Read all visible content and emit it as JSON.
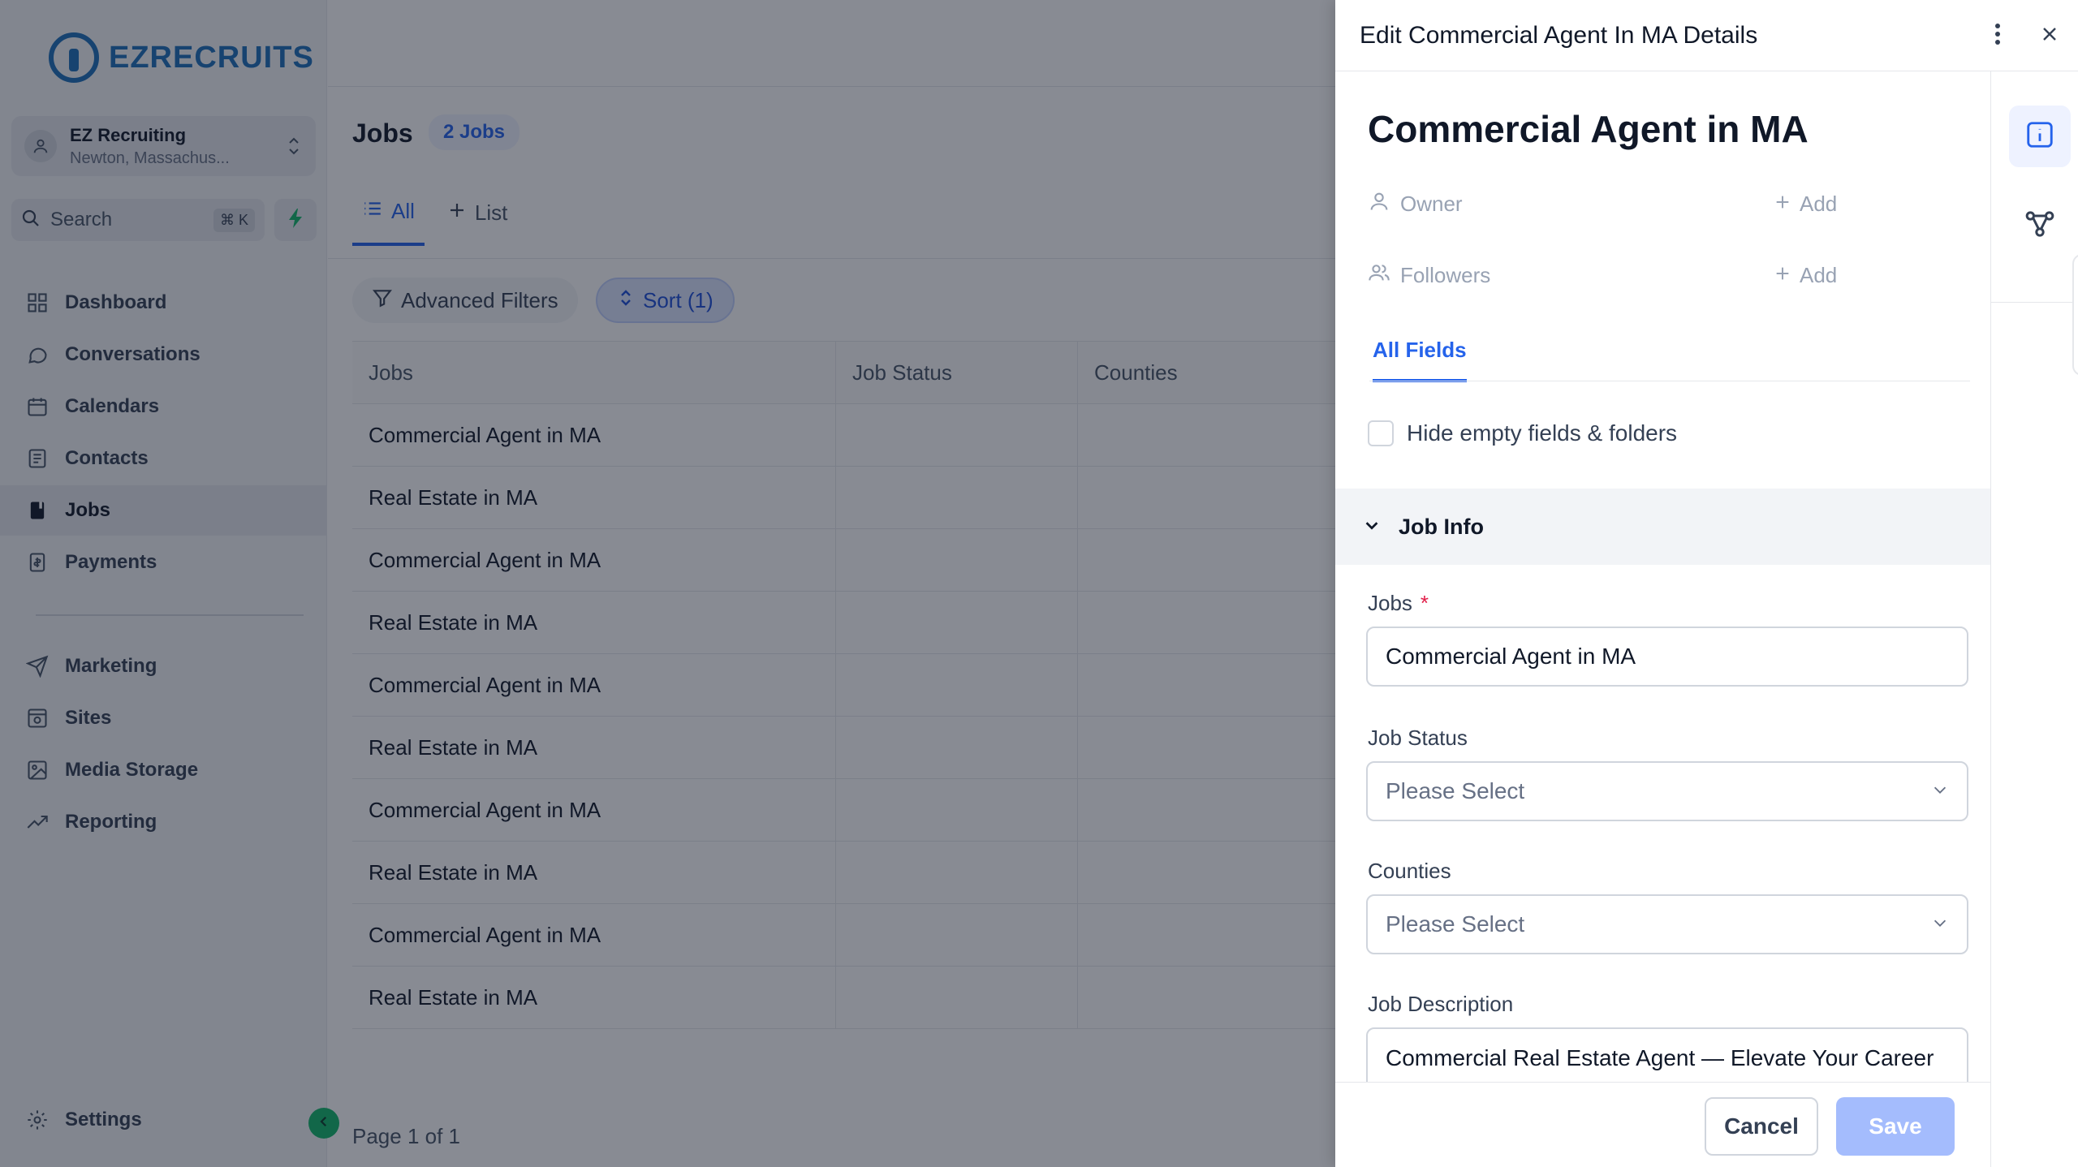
{
  "brand": {
    "name": "EZRECRUITS"
  },
  "account": {
    "name": "EZ Recruiting",
    "location": "Newton, Massachus..."
  },
  "search": {
    "label": "Search",
    "shortcut": "⌘ K"
  },
  "nav": {
    "dashboard": "Dashboard",
    "conversations": "Conversations",
    "calendars": "Calendars",
    "contacts": "Contacts",
    "jobs": "Jobs",
    "payments": "Payments",
    "marketing": "Marketing",
    "sites": "Sites",
    "media_storage": "Media Storage",
    "reporting": "Reporting",
    "settings": "Settings"
  },
  "main": {
    "title": "Jobs",
    "count_badge": "2 Jobs",
    "tabs": {
      "all": "All",
      "list": "List"
    },
    "filters": {
      "advanced": "Advanced Filters",
      "sort": "Sort (1)"
    },
    "table": {
      "headers": [
        "Jobs",
        "Job Status",
        "Counties"
      ],
      "rows": [
        "Commercial Agent in MA",
        "Real Estate in MA",
        "Commercial Agent in MA",
        "Real Estate in MA",
        "Commercial Agent in MA",
        "Real Estate in MA",
        "Commercial Agent in MA",
        "Real Estate in MA",
        "Commercial Agent in MA",
        "Real Estate in MA"
      ]
    },
    "pagination": "Page 1 of 1"
  },
  "drawer": {
    "title": "Edit Commercial Agent In MA Details",
    "record_name": "Commercial Agent in MA",
    "owner_label": "Owner",
    "followers_label": "Followers",
    "add_label": "Add",
    "fields_tab": "All Fields",
    "hide_empty": "Hide empty fields & folders",
    "section": "Job Info",
    "fields": {
      "jobs_label": "Jobs",
      "jobs_required": "*",
      "jobs_value": "Commercial Agent in MA",
      "status_label": "Job Status",
      "status_placeholder": "Please Select",
      "counties_label": "Counties",
      "counties_placeholder": "Please Select",
      "description_label": "Job Description",
      "description_value": "Commercial Real Estate Agent — Elevate Your Career"
    },
    "buttons": {
      "cancel": "Cancel",
      "save": "Save"
    }
  },
  "colors": {
    "accent": "#2563eb",
    "brand": "#1d6fb8",
    "save_disabled": "#a4bcfd",
    "green": "#12b76a"
  }
}
